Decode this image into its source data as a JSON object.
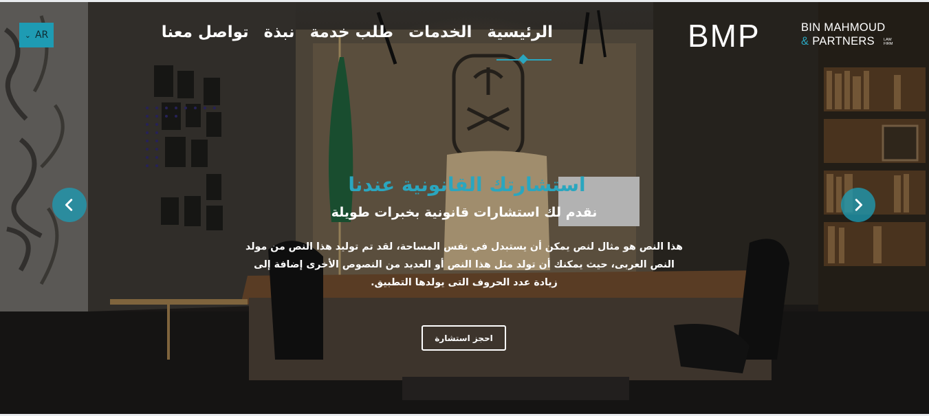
{
  "header": {
    "language": "AR",
    "nav": [
      {
        "label": "الرئيسية",
        "active": true
      },
      {
        "label": "الخدمات",
        "active": false
      },
      {
        "label": "طلب خدمة",
        "active": false
      },
      {
        "label": "نبذة",
        "active": false
      },
      {
        "label": "تواصل معنا",
        "active": false
      }
    ],
    "logo": {
      "mark": "BMP",
      "line1": "BIN MAHMOUD",
      "line2_amp": "&",
      "line2": "PARTNERS",
      "small_line1": "LAW",
      "small_line2": "FIRM"
    }
  },
  "hero": {
    "title": "استشارتك القانونية عندنا",
    "subtitle": "نقدم لك استشارات قانونية بخبرات طويلة",
    "text": "هذا النص هو مثال لنص يمكن أن يستبدل في نفس المساحة، لقد تم توليد هذا النص من مولد النص العربى، حيث يمكنك أن تولد مثل هذا النص أو العديد من النصوص الأخرى إضافة إلى زيادة عدد الحروف التى يولدها التطبيق.",
    "cta_label": "احجز استشارة"
  },
  "colors": {
    "accent": "#1e9bb3",
    "text": "#ffffff"
  }
}
